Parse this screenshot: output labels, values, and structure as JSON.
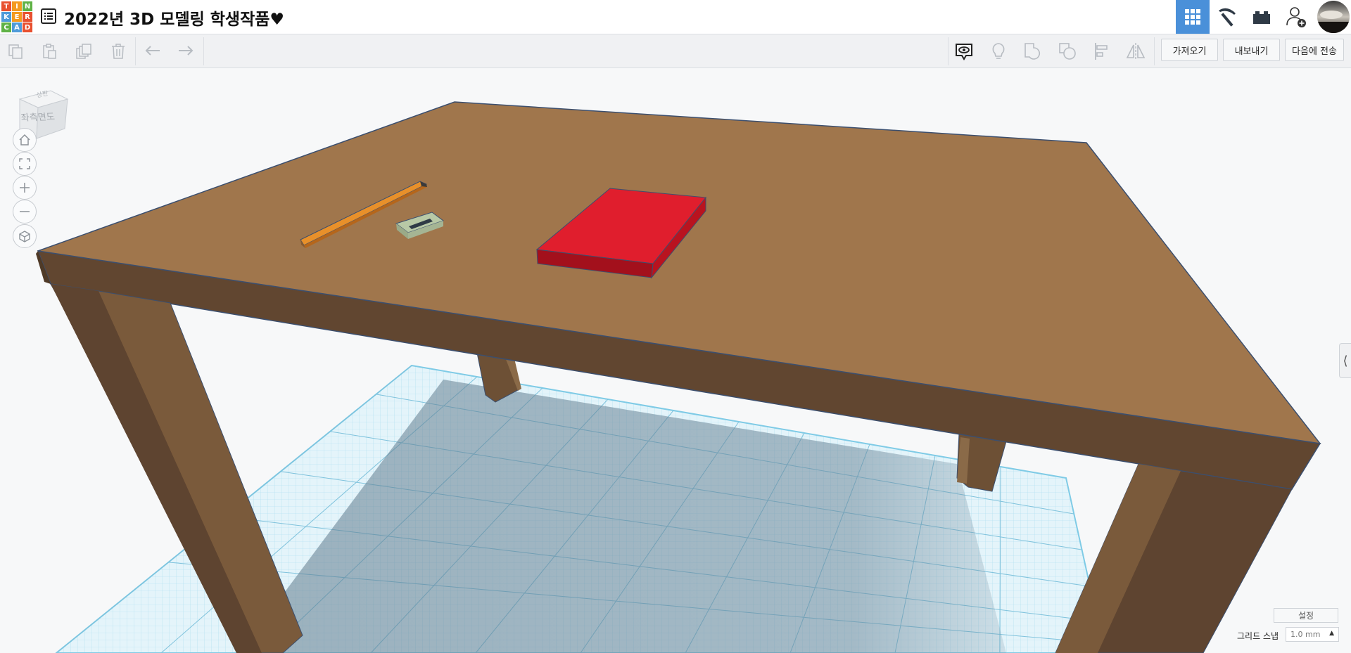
{
  "app": {
    "logo_letters": [
      "T",
      "I",
      "N",
      "K",
      "E",
      "R",
      "C",
      "A",
      "D"
    ],
    "logo_colors": [
      "#e8502f",
      "#f49a1f",
      "#5fb246",
      "#4f9bd9",
      "#f49a1f",
      "#e8502f",
      "#5fb246",
      "#4f9bd9",
      "#e8502f"
    ],
    "design_title": "2022년 3D 모델링 학생작품♥",
    "accent": "#4a90d9"
  },
  "topnav": {
    "items": [
      {
        "name": "3d-design-view",
        "icon": "grid-icon",
        "active": true
      },
      {
        "name": "blocks-view",
        "icon": "pickaxe-icon",
        "active": false
      },
      {
        "name": "bricks-view",
        "icon": "brick-icon",
        "active": false
      },
      {
        "name": "invite-user",
        "icon": "add-user-icon",
        "active": false
      },
      {
        "name": "account",
        "icon": "avatar",
        "active": false
      }
    ]
  },
  "toolbar": {
    "import_label": "가져오기",
    "export_label": "내보내기",
    "send_to_label": "다음에 전송"
  },
  "viewport": {
    "viewcube_label": "좌측면도",
    "viewcube_top_label": "상판",
    "objects": [
      "table",
      "pencil",
      "eraser",
      "red-book"
    ],
    "colors": {
      "table_top": "#a0764c",
      "table_side": "#5f452e",
      "leg_front": "#7a5a3b",
      "book": "#e01e2d",
      "pencil": "#e8902a",
      "eraser": "#b8c9a6",
      "grid": "#9fd9ee"
    }
  },
  "bottom_right": {
    "settings_label": "설정",
    "grid_snap_label": "그리드 스냅",
    "grid_snap_value": "1.0 mm"
  }
}
